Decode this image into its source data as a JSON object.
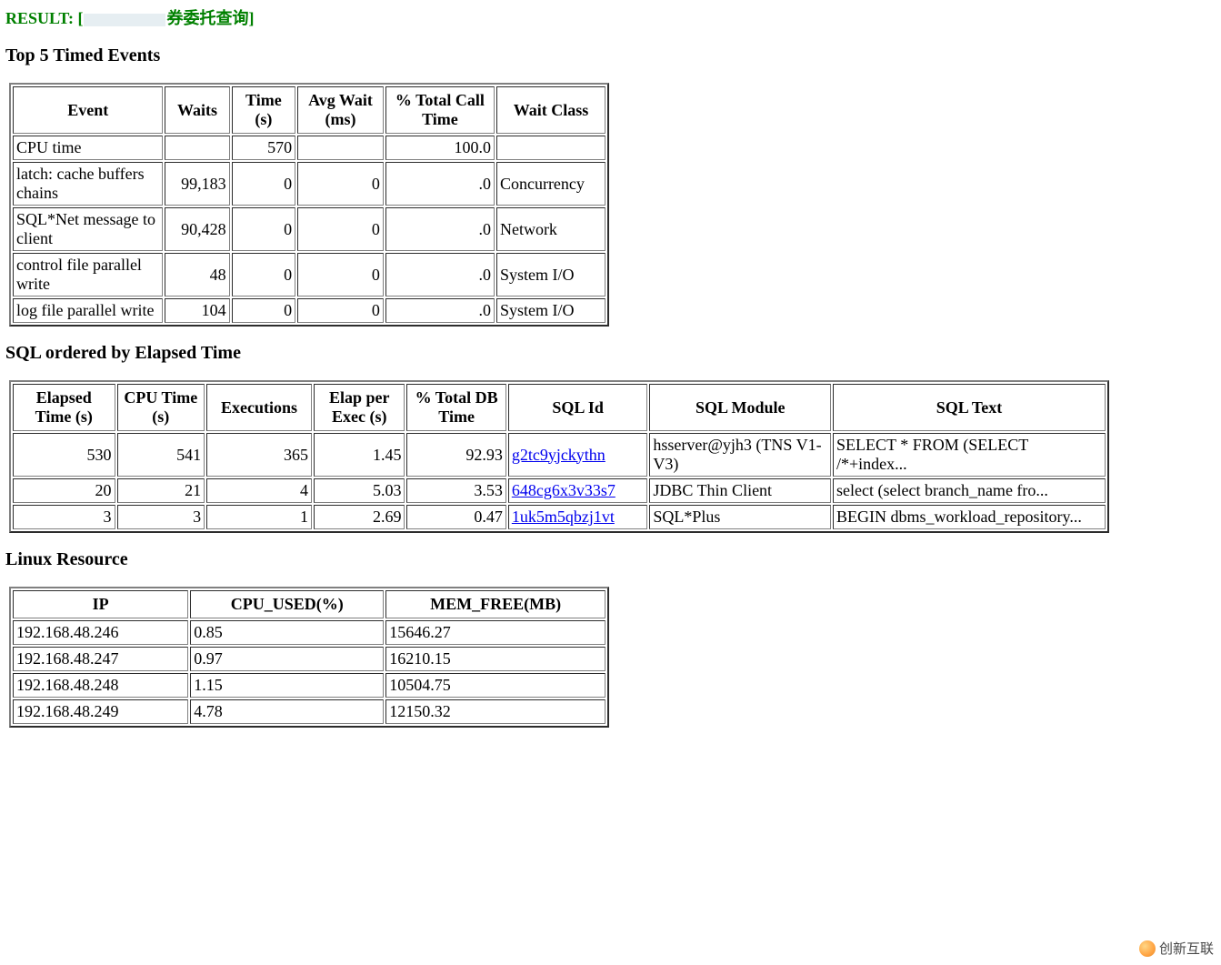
{
  "result": {
    "prefix": "RESULT: [",
    "tail": "券委托查询]"
  },
  "sections": {
    "top5": "Top 5 Timed Events",
    "sql": "SQL ordered by Elapsed Time",
    "linux": "Linux Resource"
  },
  "top5": {
    "headers": [
      "Event",
      "Waits",
      "Time (s)",
      "Avg Wait (ms)",
      "% Total Call Time",
      "Wait Class"
    ],
    "rows": [
      {
        "event": "CPU time",
        "waits": "",
        "time": "570",
        "avg": "",
        "pct": "100.0",
        "class": ""
      },
      {
        "event": "latch: cache buffers chains",
        "waits": "99,183",
        "time": "0",
        "avg": "0",
        "pct": ".0",
        "class": "Concurrency"
      },
      {
        "event": "SQL*Net message to client",
        "waits": "90,428",
        "time": "0",
        "avg": "0",
        "pct": ".0",
        "class": "Network"
      },
      {
        "event": "control file parallel write",
        "waits": "48",
        "time": "0",
        "avg": "0",
        "pct": ".0",
        "class": "System I/O"
      },
      {
        "event": "log file parallel write",
        "waits": "104",
        "time": "0",
        "avg": "0",
        "pct": ".0",
        "class": "System I/O"
      }
    ]
  },
  "sql": {
    "headers": [
      "Elapsed Time (s)",
      "CPU Time (s)",
      "Executions",
      "Elap per Exec (s)",
      "% Total DB Time",
      "SQL Id",
      "SQL Module",
      "SQL Text"
    ],
    "rows": [
      {
        "elapsed": "530",
        "cpu": "541",
        "exec": "365",
        "per": "1.45",
        "pct": "92.93",
        "id": "g2tc9yjckythn",
        "module": "hsserver@yjh3 (TNS V1-V3)",
        "text": "SELECT * FROM (SELECT /*+index..."
      },
      {
        "elapsed": "20",
        "cpu": "21",
        "exec": "4",
        "per": "5.03",
        "pct": "3.53",
        "id": "648cg6x3v33s7",
        "module": "JDBC Thin Client",
        "text": "select (select branch_name fro..."
      },
      {
        "elapsed": "3",
        "cpu": "3",
        "exec": "1",
        "per": "2.69",
        "pct": "0.47",
        "id": "1uk5m5qbzj1vt",
        "module": "SQL*Plus",
        "text": "BEGIN dbms_workload_repository..."
      }
    ]
  },
  "linux": {
    "headers": [
      "IP",
      "CPU_USED(%)",
      "MEM_FREE(MB)"
    ],
    "rows": [
      {
        "ip": "192.168.48.246",
        "cpu": "0.85",
        "mem": "15646.27"
      },
      {
        "ip": "192.168.48.247",
        "cpu": "0.97",
        "mem": "16210.15"
      },
      {
        "ip": "192.168.48.248",
        "cpu": "1.15",
        "mem": "10504.75"
      },
      {
        "ip": "192.168.48.249",
        "cpu": "4.78",
        "mem": "12150.32"
      }
    ]
  },
  "watermark": "创新互联"
}
